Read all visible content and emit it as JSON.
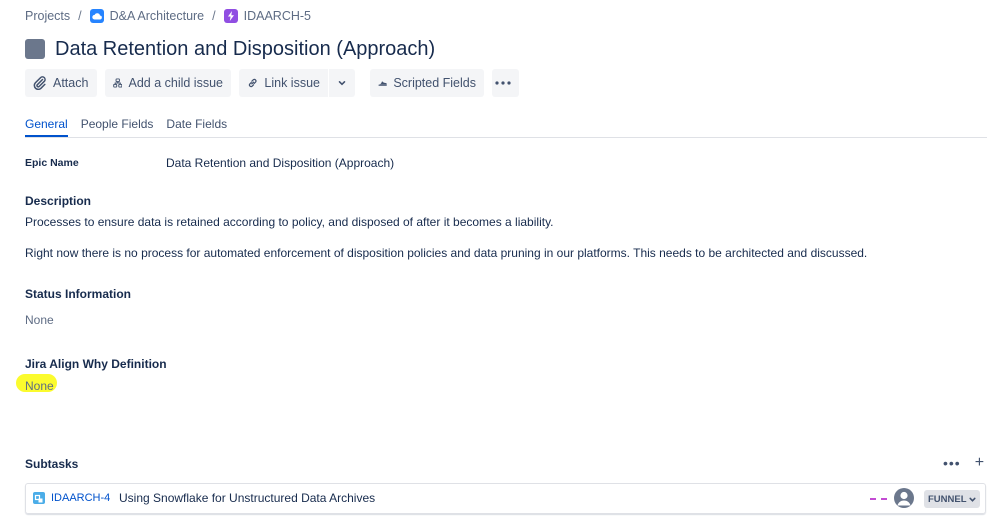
{
  "breadcrumb": {
    "items": [
      {
        "label": "Projects"
      },
      {
        "label": "D&A Architecture",
        "icon": "cloud-icon"
      },
      {
        "label": "IDAARCH-5",
        "icon": "epic-icon"
      }
    ],
    "separator": "/"
  },
  "issue": {
    "title": "Data Retention and Disposition (Approach)",
    "type_icon": "epic-type-icon"
  },
  "toolbar": {
    "attach_label": "Attach",
    "add_child_label": "Add a child issue",
    "link_issue_label": "Link issue",
    "scripted_fields_label": "Scripted Fields"
  },
  "tabs": [
    {
      "label": "General",
      "active": true
    },
    {
      "label": "People Fields",
      "active": false
    },
    {
      "label": "Date Fields",
      "active": false
    }
  ],
  "fields": {
    "epic_name": {
      "label": "Epic Name",
      "value": "Data Retention and Disposition (Approach)"
    },
    "description": {
      "label": "Description",
      "line1": "Processes to ensure data is retained according to policy, and disposed of after it becomes a liability.",
      "line2": "Right now there is no process for automated enforcement of disposition policies and data pruning in our platforms.  This needs to be architected and discussed."
    },
    "status_information": {
      "label": "Status Information",
      "value": "None"
    },
    "jira_align_why": {
      "label": "Jira Align Why Definition",
      "value": "None"
    }
  },
  "subtasks": {
    "title": "Subtasks",
    "more_label": "•••",
    "add_label": "+",
    "items": [
      {
        "key": "IDAARCH-4",
        "summary": "Using Snowflake for Unstructured Data Archives",
        "status": "FUNNEL"
      }
    ]
  },
  "colors": {
    "link": "#0052cc",
    "text": "#172b4d",
    "muted": "#5e6c84",
    "highlight": "#fbfb2e",
    "epic": "#904ee2",
    "project": "#2684ff",
    "subtask_icon": "#4bade8",
    "priority": "#c34bd3"
  }
}
